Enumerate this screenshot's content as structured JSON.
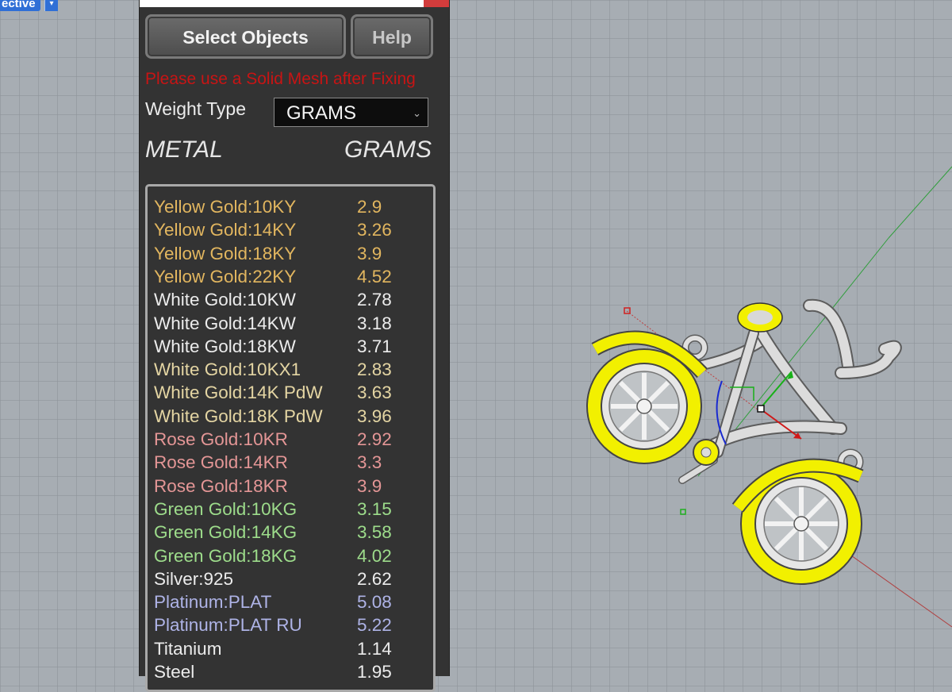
{
  "viewport": {
    "tab_label": "ective",
    "tab_arrow": "▾"
  },
  "panel": {
    "select_button": "Select Objects",
    "help_button": "Help",
    "warning": "Please use a Solid Mesh after Fixing",
    "weight_type_label": "Weight Type",
    "weight_type_value": "GRAMS",
    "dropdown_arrow": "⌄",
    "col_metal": "METAL",
    "col_grams": "GRAMS"
  },
  "colors": {
    "yellow": "#e2b65f",
    "white": "#ececec",
    "white_gold_alt": "#e4d5a3",
    "rose": "#e49696",
    "green": "#9ddc8b",
    "platinum": "#aeb3e6",
    "warning": "#c81414",
    "model_yellow": "#f2f000"
  },
  "metals": [
    {
      "name": "Yellow Gold:10KY",
      "grams": "2.9",
      "color": "#e2b65f"
    },
    {
      "name": "Yellow Gold:14KY",
      "grams": "3.26",
      "color": "#e2b65f"
    },
    {
      "name": "Yellow Gold:18KY",
      "grams": "3.9",
      "color": "#e2b65f"
    },
    {
      "name": "Yellow Gold:22KY",
      "grams": "4.52",
      "color": "#e2b65f"
    },
    {
      "name": "White Gold:10KW",
      "grams": "2.78",
      "color": "#ececec"
    },
    {
      "name": "White Gold:14KW",
      "grams": "3.18",
      "color": "#ececec"
    },
    {
      "name": "White Gold:18KW",
      "grams": "3.71",
      "color": "#ececec"
    },
    {
      "name": "White Gold:10KX1",
      "grams": "2.83",
      "color": "#e4d5a3"
    },
    {
      "name": "White Gold:14K PdW",
      "grams": "3.63",
      "color": "#e4d5a3"
    },
    {
      "name": "White Gold:18K PdW",
      "grams": "3.96",
      "color": "#e4d5a3"
    },
    {
      "name": "Rose Gold:10KR",
      "grams": "2.92",
      "color": "#e49696"
    },
    {
      "name": "Rose Gold:14KR",
      "grams": "3.3",
      "color": "#e49696"
    },
    {
      "name": "Rose Gold:18KR",
      "grams": "3.9",
      "color": "#e49696"
    },
    {
      "name": "Green Gold:10KG",
      "grams": "3.15",
      "color": "#9ddc8b"
    },
    {
      "name": "Green Gold:14KG",
      "grams": "3.58",
      "color": "#9ddc8b"
    },
    {
      "name": "Green Gold:18KG",
      "grams": "4.02",
      "color": "#9ddc8b"
    },
    {
      "name": "Silver:925",
      "grams": "2.62",
      "color": "#ececec"
    },
    {
      "name": "Platinum:PLAT",
      "grams": "5.08",
      "color": "#aeb3e6"
    },
    {
      "name": "Platinum:PLAT RU",
      "grams": "5.22",
      "color": "#aeb3e6"
    },
    {
      "name": "Titanium",
      "grams": "1.14",
      "color": "#ececec"
    },
    {
      "name": "Steel",
      "grams": "1.95",
      "color": "#ececec"
    }
  ]
}
